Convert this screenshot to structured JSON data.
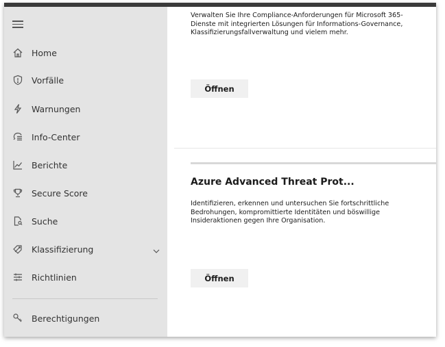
{
  "sidebar": {
    "menu_icon": "hamburger-icon",
    "items": [
      {
        "label": "Home",
        "icon": "home-icon"
      },
      {
        "label": "Vorfälle",
        "icon": "shield-icon"
      },
      {
        "label": "Warnungen",
        "icon": "lightning-icon"
      },
      {
        "label": "Info-Center",
        "icon": "message-center-icon"
      },
      {
        "label": "Berichte",
        "icon": "chart-line-icon"
      },
      {
        "label": "Secure Score",
        "icon": "trophy-icon"
      },
      {
        "label": "Suche",
        "icon": "search-document-icon"
      },
      {
        "label": "Klassifizierung",
        "icon": "tag-icon"
      },
      {
        "label": "Richtlinien",
        "icon": "sliders-icon"
      },
      {
        "label": "Berechtigungen",
        "icon": "key-icon"
      }
    ]
  },
  "cards": [
    {
      "description": "Verwalten Sie Ihre Compliance-Anforderungen für Microsoft 365-Dienste mit integrierten Lösungen für Informations-Governance, Klassifizierungsfallverwaltung und vielem mehr.",
      "button_label": "Öffnen"
    },
    {
      "title": "Azure Advanced Threat Prot...",
      "description": "Identifizieren, erkennen und untersuchen Sie fortschrittliche Bedrohungen, kompromittierte Identitäten und böswillige Insideraktionen gegen Ihre Organisation.",
      "button_label": "Öffnen"
    }
  ],
  "colors": {
    "sidebar_bg": "#e4e4e4",
    "topbar": "#3a3a3a",
    "button_bg": "#f0f0f0"
  }
}
